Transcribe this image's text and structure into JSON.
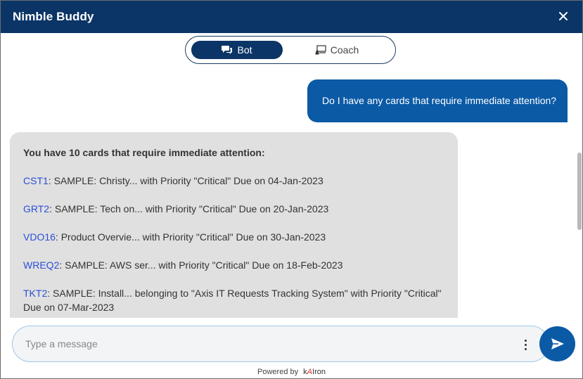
{
  "header": {
    "title": "Nimble Buddy"
  },
  "modes": {
    "bot_label": "Bot",
    "coach_label": "Coach",
    "active": "Bot"
  },
  "conversation": {
    "user_message": "Do I have any cards that require immediate attention?",
    "bot_intro": "You have 10 cards that require immediate attention:",
    "cards": [
      {
        "id": "CST1",
        "text": ": SAMPLE: Christy... with Priority \"Critical\" Due on 04-Jan-2023"
      },
      {
        "id": "GRT2",
        "text": ": SAMPLE: Tech on... with Priority \"Critical\" Due on 20-Jan-2023"
      },
      {
        "id": "VDO16",
        "text": ": Product Overvie... with Priority \"Critical\" Due on 30-Jan-2023"
      },
      {
        "id": "WREQ2",
        "text": ": SAMPLE: AWS ser... with Priority \"Critical\" Due on 18-Feb-2023"
      },
      {
        "id": "TKT2",
        "text": ": SAMPLE: Install... belonging to \"Axis IT Requests Tracking System\" with Priority \"Critical\" Due on 07-Mar-2023"
      }
    ]
  },
  "composer": {
    "placeholder": "Type a message"
  },
  "footer": {
    "powered_by": "Powered by",
    "logo_prefix": "k",
    "logo_accent": "A",
    "logo_suffix": "Iron"
  },
  "colors": {
    "header": "#0b3566",
    "user_bubble": "#0b5aa6",
    "bot_bubble": "#e0e0e0",
    "link": "#2a4fd6"
  },
  "icons": [
    "close-icon",
    "chat-bubbles-icon",
    "coach-icon",
    "more-vertical-icon",
    "send-icon"
  ]
}
